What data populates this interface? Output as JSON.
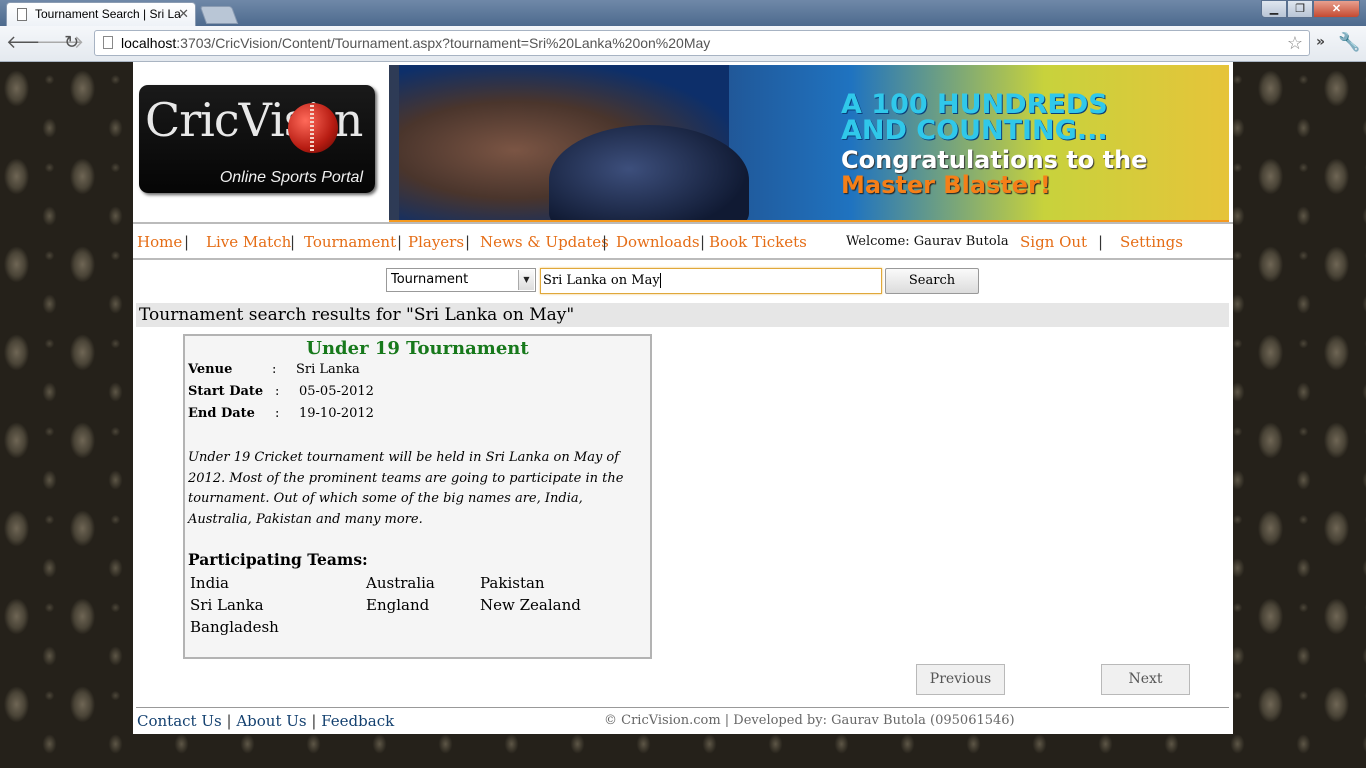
{
  "browser": {
    "tab_title": "Tournament Search | Sri La",
    "url_host": "localhost",
    "url_rest": ":3703/CricVision/Content/Tournament.aspx?tournament=Sri%20Lanka%20on%20May"
  },
  "site": {
    "logo_text": "CricVisi  n",
    "logo_subtitle": "Online Sports Portal",
    "banner": {
      "line1": "A 100 HUNDREDS",
      "line2": "AND COUNTING...",
      "line3": "Congratulations to the",
      "line4": "Master Blaster!"
    },
    "menu": {
      "home": "Home",
      "live_match": "Live Match",
      "tournament": "Tournament",
      "players": "Players",
      "news": "News & Updates",
      "downloads": "Downloads",
      "book_tickets": "Book Tickets",
      "welcome": "Welcome: Gaurav Butola",
      "sign_out": "Sign Out",
      "settings": "Settings",
      "separator": "|"
    },
    "search": {
      "category": "Tournament",
      "query": "Sri Lanka on May",
      "button": "Search"
    },
    "results_heading": "Tournament search results for \"Sri Lanka on May\"",
    "result": {
      "title": "Under 19 Tournament",
      "venue_label": "Venue",
      "venue": "Sri Lanka",
      "start_label": "Start Date",
      "start_date": "05-05-2012",
      "end_label": "End Date",
      "end_date": "19-10-2012",
      "colon": ":",
      "description": "Under 19 Cricket tournament will be held in Sri Lanka on May of 2012. Most of the prominent teams are going to participate in the tournament. Out of which some of the big names are, India, Australia, Pakistan and many more.",
      "teams_heading": "Participating Teams:",
      "teams": [
        "India",
        "Australia",
        "Pakistan",
        "Sri Lanka",
        "England",
        "New Zealand",
        "Bangladesh"
      ]
    },
    "pager": {
      "previous": "Previous",
      "next": "Next"
    },
    "footer": {
      "contact": "Contact Us",
      "about": "About Us",
      "feedback": "Feedback",
      "copyright": "© CricVision.com | Developed by: Gaurav Butola (095061546)"
    }
  },
  "icons": {
    "back": "back-arrow-icon",
    "forward": "forward-arrow-icon",
    "reload": "reload-icon",
    "star": "star-icon",
    "wrench": "wrench-icon"
  }
}
